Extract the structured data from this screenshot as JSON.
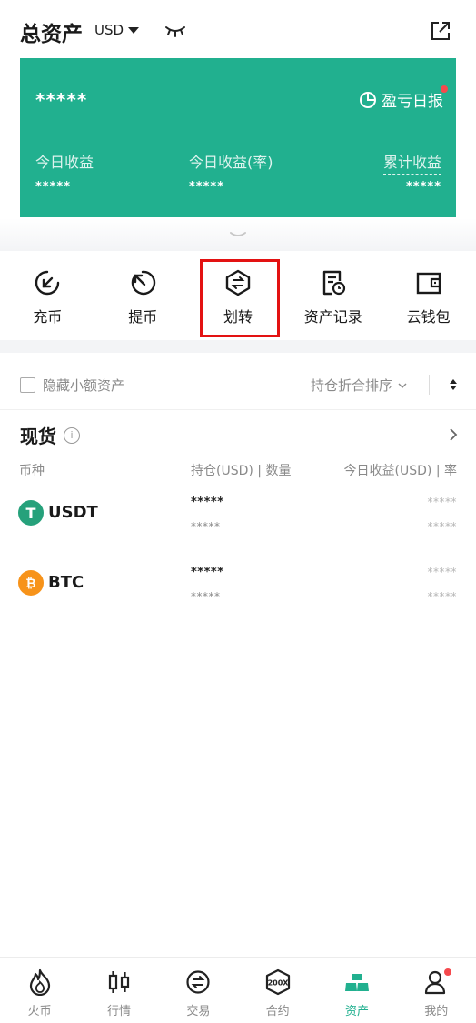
{
  "header": {
    "title": "总资产",
    "currency": "USD",
    "eye_icon": "eye-closed-icon",
    "share_icon": "share-out-icon"
  },
  "card": {
    "total_masked": "*****",
    "report_label": "盈亏日报",
    "stats": [
      {
        "label": "今日收益",
        "value": "*****"
      },
      {
        "label": "今日收益(率)",
        "value": "*****"
      },
      {
        "label": "累计收益",
        "value": "*****"
      }
    ],
    "bg_color": "#21b08f"
  },
  "actions": [
    {
      "label": "充币",
      "icon": "deposit-icon"
    },
    {
      "label": "提币",
      "icon": "withdraw-icon"
    },
    {
      "label": "划转",
      "icon": "transfer-icon",
      "highlighted": true
    },
    {
      "label": "资产记录",
      "icon": "records-icon"
    },
    {
      "label": "云钱包",
      "icon": "wallet-icon"
    }
  ],
  "filter": {
    "hide_small": "隐藏小额资产",
    "sort_label": "持仓折合排序"
  },
  "spot": {
    "title": "现货",
    "columns": [
      "币种",
      "持仓(USD) | 数量",
      "今日收益(USD) | 率"
    ],
    "coins": [
      {
        "name": "USDT",
        "hold": "*****",
        "qty": "*****",
        "pnl": "*****",
        "rate": "*****",
        "color": "#26a17b",
        "glyph": "T"
      },
      {
        "name": "BTC",
        "hold": "*****",
        "qty": "*****",
        "pnl": "*****",
        "rate": "*****",
        "color": "#f7931a",
        "glyph": "₿"
      }
    ]
  },
  "nav": [
    {
      "label": "火币",
      "icon": "flame-icon"
    },
    {
      "label": "行情",
      "icon": "candlestick-icon"
    },
    {
      "label": "交易",
      "icon": "exchange-icon"
    },
    {
      "label": "合约",
      "icon": "contract-200x-icon",
      "badge_text": "200X"
    },
    {
      "label": "资产",
      "icon": "assets-icon",
      "active": true
    },
    {
      "label": "我的",
      "icon": "profile-icon",
      "dot": true
    }
  ],
  "accent_color": "#21b08f",
  "highlight_color": "#e31212"
}
